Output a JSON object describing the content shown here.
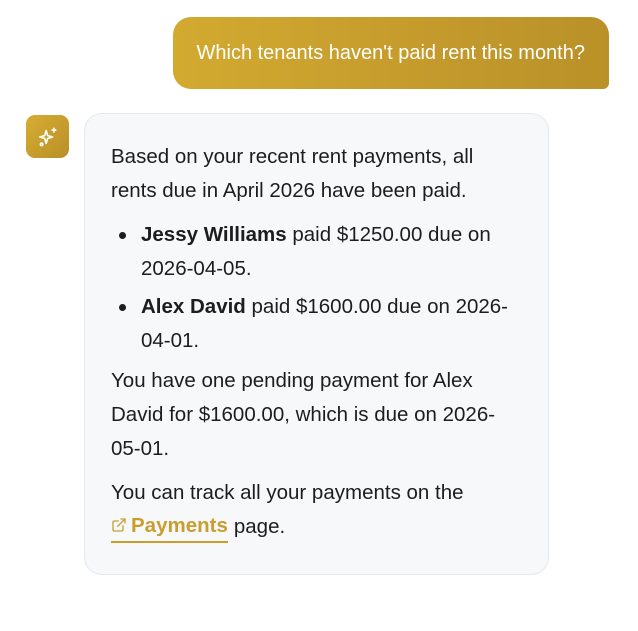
{
  "user_message": {
    "text": "Which tenants haven't paid rent this month?"
  },
  "assistant": {
    "avatar_icon": "sparkles-icon",
    "intro": "Based on your recent rent payments, all rents due in April 2026 have been paid.",
    "payments": [
      {
        "name": "Jessy Williams",
        "detail": " paid $1250.00 due on 2026-04-05."
      },
      {
        "name": "Alex David",
        "detail": " paid $1600.00 due on 2026-04-01."
      }
    ],
    "pending": "You have one pending payment for Alex David for $1600.00, which is due on 2026-05-01.",
    "track_prefix": "You can track all your payments on the",
    "link_label": "Payments",
    "link_icon": "external-link-icon",
    "track_suffix": "page."
  },
  "colors": {
    "accent": "#c99e2e",
    "user_bubble": "#c9a12e",
    "card_background": "#f7f8fa"
  }
}
